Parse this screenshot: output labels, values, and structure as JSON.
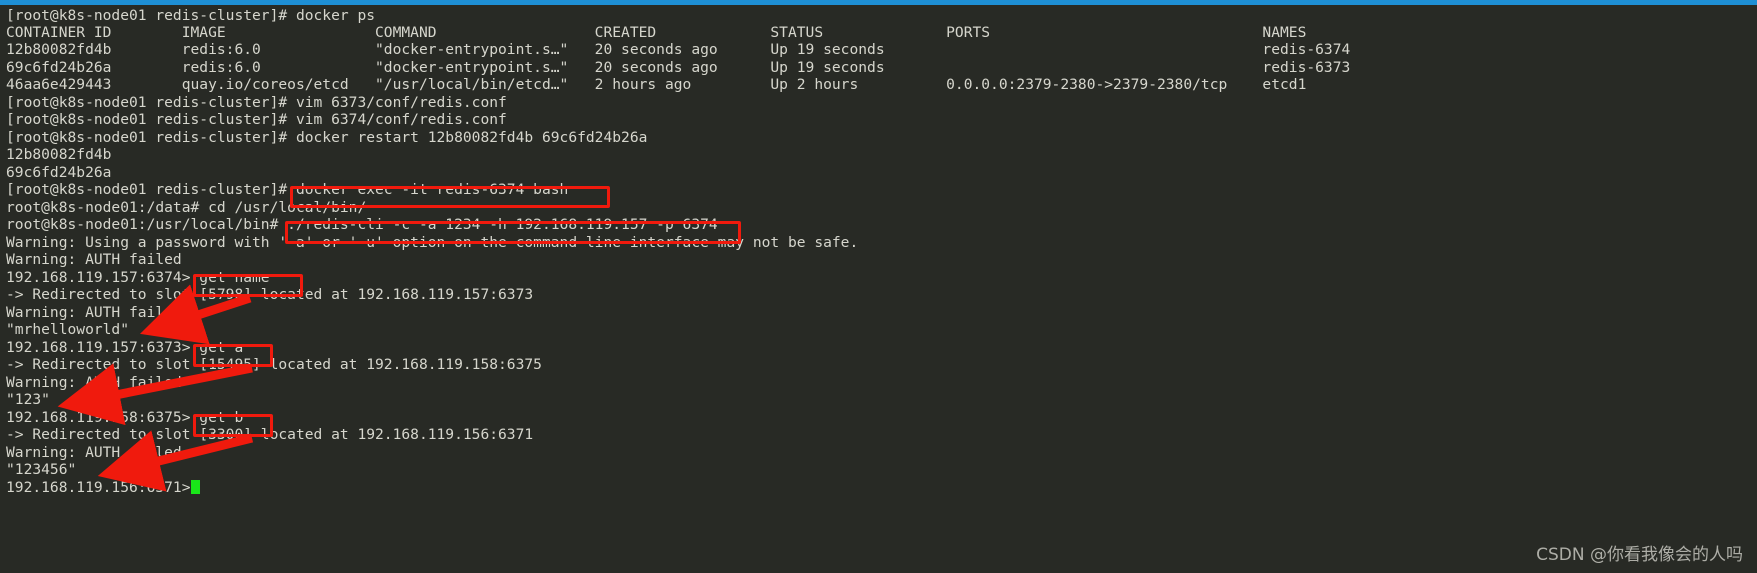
{
  "window": {
    "title_bar_color": "#1e8fd5",
    "background_color": "#282a25",
    "foreground_color": "#d6d6cd",
    "annotation_color": "#f01a0d",
    "cursor_color": "#19e619"
  },
  "terminal": {
    "lines": [
      "[root@k8s-node01 redis-cluster]# docker ps",
      "CONTAINER ID        IMAGE                 COMMAND                  CREATED             STATUS              PORTS                               NAMES",
      "12b80082fd4b        redis:6.0             \"docker-entrypoint.s…\"   20 seconds ago      Up 19 seconds                                           redis-6374",
      "69c6fd24b26a        redis:6.0             \"docker-entrypoint.s…\"   20 seconds ago      Up 19 seconds                                           redis-6373",
      "46aa6e429443        quay.io/coreos/etcd   \"/usr/local/bin/etcd…\"   2 hours ago         Up 2 hours          0.0.0.0:2379-2380->2379-2380/tcp    etcd1",
      "[root@k8s-node01 redis-cluster]# vim 6373/conf/redis.conf",
      "[root@k8s-node01 redis-cluster]# vim 6374/conf/redis.conf",
      "[root@k8s-node01 redis-cluster]# docker restart 12b80082fd4b 69c6fd24b26a",
      "12b80082fd4b",
      "69c6fd24b26a",
      "[root@k8s-node01 redis-cluster]# docker exec -it redis-6374 bash",
      "root@k8s-node01:/data# cd /usr/local/bin/",
      "root@k8s-node01:/usr/local/bin# ./redis-cli -c -a 1234 -h 192.168.119.157 -p 6374",
      "Warning: Using a password with '-a' or '-u' option on the command line interface may not be safe.",
      "Warning: AUTH failed",
      "192.168.119.157:6374> get name",
      "-> Redirected to slot [5798] located at 192.168.119.157:6373",
      "Warning: AUTH failed",
      "\"mrhelloworld\"",
      "192.168.119.157:6373> get a",
      "-> Redirected to slot [15495] located at 192.168.119.158:6375",
      "Warning: AUTH failed",
      "\"123\"",
      "192.168.119.158:6375> get b",
      "-> Redirected to slot [3300] located at 192.168.119.156:6371",
      "Warning: AUTH failed",
      "\"123456\"",
      "192.168.119.156:6371> "
    ],
    "prompt_host": "[root@k8s-node01 redis-cluster]#",
    "container_prompt_data": "root@k8s-node01:/data#",
    "container_prompt_bin": "root@k8s-node01:/usr/local/bin#",
    "final_prompt": "192.168.119.156:6371>"
  },
  "docker_ps_table": {
    "headers": [
      "CONTAINER ID",
      "IMAGE",
      "COMMAND",
      "CREATED",
      "STATUS",
      "PORTS",
      "NAMES"
    ],
    "rows": [
      [
        "12b80082fd4b",
        "redis:6.0",
        "\"docker-entrypoint.s…\"",
        "20 seconds ago",
        "Up 19 seconds",
        "",
        "redis-6374"
      ],
      [
        "69c6fd24b26a",
        "redis:6.0",
        "\"docker-entrypoint.s…\"",
        "20 seconds ago",
        "Up 19 seconds",
        "",
        "redis-6373"
      ],
      [
        "46aa6e429443",
        "quay.io/coreos/etcd",
        "\"/usr/local/bin/etcd…\"",
        "2 hours ago",
        "Up 2 hours",
        "0.0.0.0:2379-2380->2379-2380/tcp",
        "etcd1"
      ]
    ]
  },
  "annotations": {
    "boxes": [
      {
        "label": "docker exec -it redis-6374 bash",
        "line": 10
      },
      {
        "label": "./redis-cli -c -a 1234 -h 192.168.119.157 -p 6374",
        "line": 12
      },
      {
        "label": "get name",
        "line": 15
      },
      {
        "label": "get a",
        "line": 19
      },
      {
        "label": "get b",
        "line": 23
      }
    ],
    "arrows": [
      {
        "from_label": "get name",
        "to_value": "\"mrhelloworld\""
      },
      {
        "from_label": "get a",
        "to_value": "\"123\""
      },
      {
        "from_label": "get b",
        "to_value": "\"123456\""
      }
    ]
  },
  "watermark": {
    "text": "CSDN @你看我像会的人吗"
  }
}
